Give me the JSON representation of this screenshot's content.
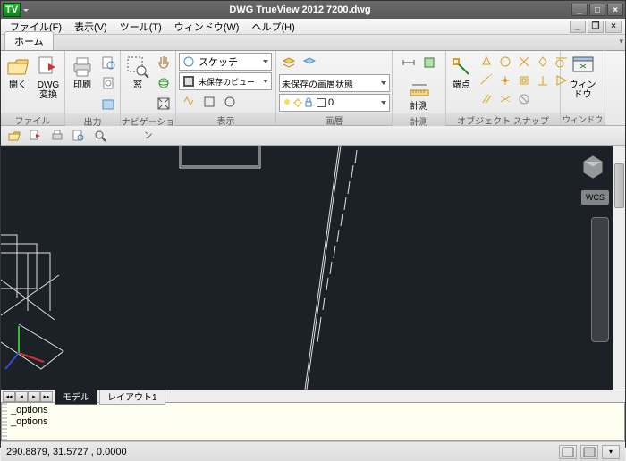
{
  "title": "DWG TrueView 2012     7200.dwg",
  "logo_text": "TV",
  "menu": {
    "file": "ファイル(F)",
    "view": "表示(V)",
    "tools": "ツール(T)",
    "window": "ウィンドウ(W)",
    "help": "ヘルプ(H)"
  },
  "home_tab": "ホーム",
  "panel_drop": "▾",
  "ribbon": {
    "file": {
      "open": "開く",
      "convert": "DWG\n変換",
      "label": "ファイル"
    },
    "output": {
      "print": "印刷",
      "label": "出力"
    },
    "nav": {
      "win": "窓",
      "label": "ナビゲーション"
    },
    "display": {
      "sketch": "スケッチ",
      "unsaved_view": "未保存のビュー",
      "label": "表示"
    },
    "layer": {
      "state": "未保存の画層状態",
      "label": "画層"
    },
    "measure": {
      "measure": "計測",
      "label": "計測"
    },
    "osnap": {
      "endpoint": "端点",
      "label": "オブジェクト スナップ"
    },
    "window": {
      "win": "ウィンドウ",
      "label": "ウィンドウ"
    }
  },
  "sheets": {
    "model": "モデル",
    "layout1": "レイアウト1"
  },
  "cmd": {
    "l1": "_options",
    "l2": "_options"
  },
  "status": {
    "coords": "290.8879, 31.5727 , 0.0000"
  },
  "wcs": "WCS"
}
